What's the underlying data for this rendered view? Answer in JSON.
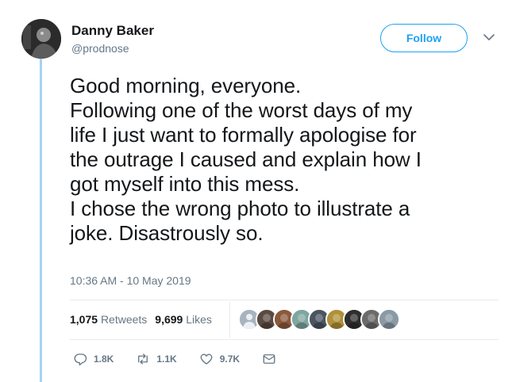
{
  "author": {
    "name": "Danny Baker",
    "handle": "@prodnose"
  },
  "follow_button": {
    "label": "Follow"
  },
  "tweet": {
    "lines": [
      "Good morning, everyone.",
      "Following one of the worst days of my",
      "life I just want to formally apologise for",
      "the outrage I caused and explain how I",
      "got myself into this mess.",
      "I chose the wrong photo to illustrate a",
      "joke. Disastrously so."
    ],
    "timestamp": "10:36 AM - 10 May 2019"
  },
  "stats": {
    "retweets_count": "1,075",
    "retweets_label": "Retweets",
    "likes_count": "9,699",
    "likes_label": "Likes"
  },
  "likers": [
    {
      "icon": "default-avatar",
      "color": "#a7b4bf"
    },
    {
      "icon": "avatar-face",
      "color": "#5a4a42"
    },
    {
      "icon": "avatar-floral",
      "color": "#8b5a3c"
    },
    {
      "icon": "avatar-cartoon",
      "color": "#7fa6a0"
    },
    {
      "icon": "avatar-bw-group",
      "color": "#4a5560"
    },
    {
      "icon": "avatar-hat",
      "color": "#b0903a"
    },
    {
      "icon": "avatar-cat",
      "color": "#2e2e2e"
    },
    {
      "icon": "avatar-portrait",
      "color": "#6b6b6b"
    },
    {
      "icon": "avatar-car",
      "color": "#8a9aa5"
    }
  ],
  "actions": {
    "replies": "1.8K",
    "retweets": "1.1K",
    "likes": "9.7K"
  },
  "colors": {
    "accent": "#1da1f2",
    "muted": "#657786",
    "thread_line": "#a3d3f5"
  }
}
